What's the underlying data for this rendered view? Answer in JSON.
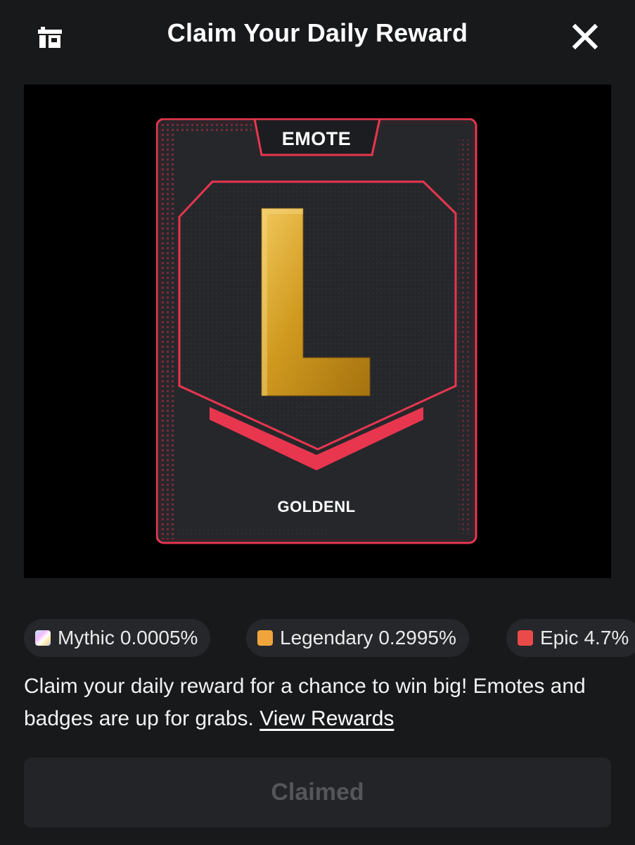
{
  "header": {
    "title": "Claim Your Daily Reward",
    "left_icon": "gift-box-icon",
    "close_icon": "close-icon"
  },
  "reward_card": {
    "type_label": "EMOTE",
    "name": "GOLDENL",
    "emote_glyph": "L",
    "rarity_color": "#e8364f",
    "glyph_color": "#d9a72a"
  },
  "odds": [
    {
      "name": "Mythic",
      "value": "0.0005%",
      "swatch": "mythic-gradient"
    },
    {
      "name": "Legendary",
      "value": "0.2995%",
      "swatch": "#f0a53c"
    },
    {
      "name": "Epic",
      "value": "4.7%",
      "swatch": "#ea4a4a"
    }
  ],
  "description": {
    "text": "Claim your daily reward for a chance to win big! Emotes and badges are up for grabs.",
    "link": "View Rewards"
  },
  "claim_button": {
    "label": "Claimed",
    "state": "disabled"
  }
}
